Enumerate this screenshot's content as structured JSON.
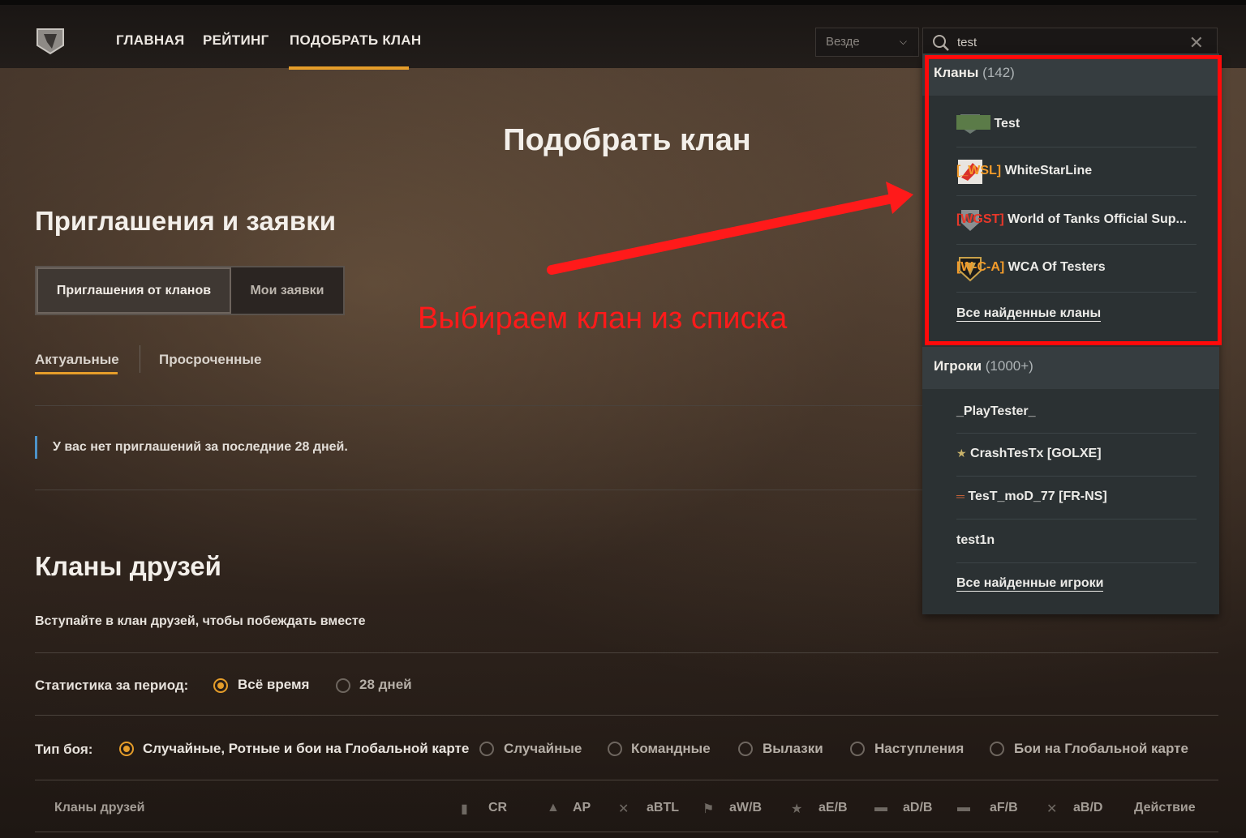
{
  "nav": {
    "items": [
      "ГЛАВНАЯ",
      "РЕЙТИНГ",
      "ПОДОБРАТЬ КЛАН"
    ],
    "active_index": 2
  },
  "search": {
    "region_value": "Везде",
    "query": "test"
  },
  "page": {
    "title": "Подобрать клан",
    "invites_heading": "Приглашения и заявки",
    "seg_tabs": [
      "Приглашения от кланов",
      "Мои заявки"
    ],
    "sub_tabs": [
      "Актуальные",
      "Просроченные"
    ],
    "no_invites": "У вас нет приглашений за последние 28 дней.",
    "friends_heading": "Кланы друзей",
    "friends_sub": "Вступайте в клан друзей, чтобы побеждать вместе",
    "period_label": "Статистика за период:",
    "period_options": [
      "Всё время",
      "28 дней"
    ],
    "battle_label": "Тип боя:",
    "battle_options": [
      "Случайные, Ротные и бои на Глобальной карте",
      "Случайные",
      "Командные",
      "Вылазки",
      "Наступления",
      "Бои на Глобальной карте"
    ],
    "table_head": {
      "clans": "Кланы друзей",
      "columns": [
        "CR",
        "AP",
        "aBTL",
        "aW/B",
        "aE/B",
        "aD/B",
        "aF/B",
        "aB/D"
      ],
      "action": "Действие"
    }
  },
  "annotation": "Выбираем клан из списка",
  "dropdown": {
    "clans_label": "Кланы",
    "clans_count": "(142)",
    "clans": [
      {
        "tag": "",
        "name": "Test",
        "tag_color": "#5f8a3e"
      },
      {
        "tag": "[_WSL]",
        "name": "WhiteStarLine",
        "tag_color": "#f39b2a"
      },
      {
        "tag": "[WGST]",
        "name": "World of Tanks Official Sup...",
        "tag_color": "#e8382a"
      },
      {
        "tag": "[W-C-A]",
        "name": "WCA Of Testers",
        "tag_color": "#f39b2a"
      }
    ],
    "all_clans_link": "Все найденные кланы",
    "players_label": "Игроки",
    "players_count": "(1000+)",
    "players": [
      "_PlayTester_",
      "CrashTesTx [GOLXE]",
      "TesT_moD_77 [FR-NS]",
      "test1n"
    ],
    "all_players_link": "Все найденные игроки"
  },
  "colors": {
    "accent": "#e59d2a",
    "annotation": "#ff1a1a",
    "dropdown_bg": "#2b3133"
  }
}
